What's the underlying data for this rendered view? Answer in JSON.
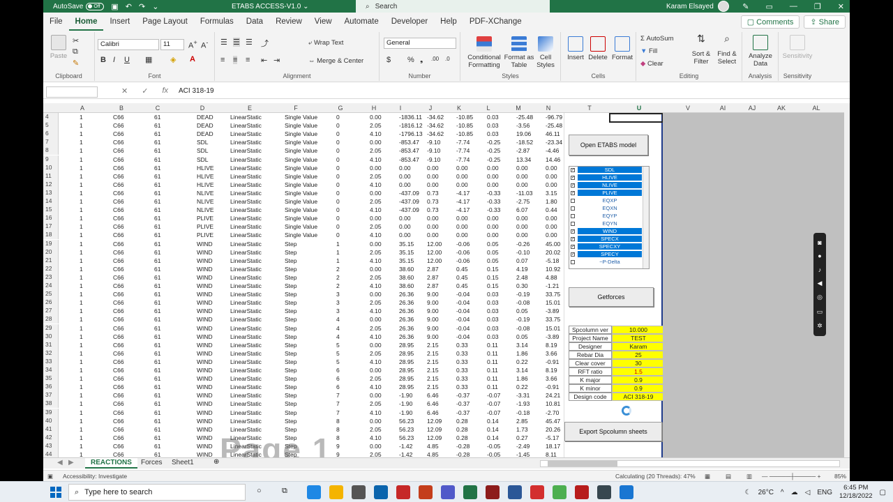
{
  "title_bar": {
    "autosave_label": "AutoSave",
    "autosave_state": "Off",
    "document_title": "ETABS ACCESS-V1.0 ⌄",
    "search_placeholder": "Search",
    "user_name": "Karam Elsayed"
  },
  "menu": {
    "tabs": [
      "File",
      "Home",
      "Insert",
      "Page Layout",
      "Formulas",
      "Data",
      "Review",
      "View",
      "Automate",
      "Developer",
      "Help",
      "PDF-XChange"
    ],
    "active_tab": "Home",
    "comments_label": "Comments",
    "share_label": "Share"
  },
  "ribbon": {
    "clipboard": {
      "paste": "Paste",
      "group": "Clipboard"
    },
    "font": {
      "name": "Calibri",
      "size": "11",
      "group": "Font"
    },
    "alignment": {
      "wrap": "Wrap Text",
      "merge": "Merge & Center",
      "group": "Alignment"
    },
    "number": {
      "format": "General",
      "group": "Number"
    },
    "styles": {
      "conditional": "Conditional Formatting",
      "format_table": "Format as Table",
      "cell_styles": "Cell Styles",
      "group": "Styles"
    },
    "cells": {
      "insert": "Insert",
      "delete": "Delete",
      "format": "Format",
      "group": "Cells"
    },
    "editing": {
      "autosum": "AutoSum",
      "fill": "Fill",
      "clear": "Clear",
      "sort": "Sort & Filter",
      "find": "Find & Select",
      "group": "Editing"
    },
    "analysis": {
      "analyze": "Analyze Data",
      "group": "Analysis"
    },
    "sensitivity": {
      "label": "Sensitivity",
      "group": "Sensitivity"
    }
  },
  "formula_bar": {
    "name_box": "",
    "content": "ACI 318-19"
  },
  "columns": [
    "A",
    "B",
    "C",
    "D",
    "E",
    "F",
    "G",
    "H",
    "I",
    "J",
    "K",
    "L",
    "M",
    "N",
    "T",
    "U",
    "V",
    "AI",
    "AJ",
    "AK",
    "AL"
  ],
  "rows": [
    [
      "4",
      "1",
      "C66",
      "61",
      "DEAD",
      "LinearStatic",
      "Single Value",
      "0",
      "0.00",
      "-1836.11",
      "-34.62",
      "-10.85",
      "0.03",
      "-25.48",
      "-96.79"
    ],
    [
      "5",
      "1",
      "C66",
      "61",
      "DEAD",
      "LinearStatic",
      "Single Value",
      "0",
      "2.05",
      "-1816.12",
      "-34.62",
      "-10.85",
      "0.03",
      "-3.56",
      "-25.48"
    ],
    [
      "6",
      "1",
      "C66",
      "61",
      "DEAD",
      "LinearStatic",
      "Single Value",
      "0",
      "4.10",
      "-1796.13",
      "-34.62",
      "-10.85",
      "0.03",
      "19.06",
      "46.11"
    ],
    [
      "7",
      "1",
      "C66",
      "61",
      "SDL",
      "LinearStatic",
      "Single Value",
      "0",
      "0.00",
      "-853.47",
      "-9.10",
      "-7.74",
      "-0.25",
      "-18.52",
      "-23.34"
    ],
    [
      "8",
      "1",
      "C66",
      "61",
      "SDL",
      "LinearStatic",
      "Single Value",
      "0",
      "2.05",
      "-853.47",
      "-9.10",
      "-7.74",
      "-0.25",
      "-2.87",
      "-4.46"
    ],
    [
      "9",
      "1",
      "C66",
      "61",
      "SDL",
      "LinearStatic",
      "Single Value",
      "0",
      "4.10",
      "-853.47",
      "-9.10",
      "-7.74",
      "-0.25",
      "13.34",
      "14.46"
    ],
    [
      "10",
      "1",
      "C66",
      "61",
      "HLIVE",
      "LinearStatic",
      "Single Value",
      "0",
      "0.00",
      "0.00",
      "0.00",
      "0.00",
      "0.00",
      "0.00",
      "0.00"
    ],
    [
      "11",
      "1",
      "C66",
      "61",
      "HLIVE",
      "LinearStatic",
      "Single Value",
      "0",
      "2.05",
      "0.00",
      "0.00",
      "0.00",
      "0.00",
      "0.00",
      "0.00"
    ],
    [
      "12",
      "1",
      "C66",
      "61",
      "HLIVE",
      "LinearStatic",
      "Single Value",
      "0",
      "4.10",
      "0.00",
      "0.00",
      "0.00",
      "0.00",
      "0.00",
      "0.00"
    ],
    [
      "13",
      "1",
      "C66",
      "61",
      "NLIVE",
      "LinearStatic",
      "Single Value",
      "0",
      "0.00",
      "-437.09",
      "0.73",
      "-4.17",
      "-0.33",
      "-11.03",
      "3.15"
    ],
    [
      "14",
      "1",
      "C66",
      "61",
      "NLIVE",
      "LinearStatic",
      "Single Value",
      "0",
      "2.05",
      "-437.09",
      "0.73",
      "-4.17",
      "-0.33",
      "-2.75",
      "1.80"
    ],
    [
      "15",
      "1",
      "C66",
      "61",
      "NLIVE",
      "LinearStatic",
      "Single Value",
      "0",
      "4.10",
      "-437.09",
      "0.73",
      "-4.17",
      "-0.33",
      "6.07",
      "0.44"
    ],
    [
      "16",
      "1",
      "C66",
      "61",
      "PLIVE",
      "LinearStatic",
      "Single Value",
      "0",
      "0.00",
      "0.00",
      "0.00",
      "0.00",
      "0.00",
      "0.00",
      "0.00"
    ],
    [
      "17",
      "1",
      "C66",
      "61",
      "PLIVE",
      "LinearStatic",
      "Single Value",
      "0",
      "2.05",
      "0.00",
      "0.00",
      "0.00",
      "0.00",
      "0.00",
      "0.00"
    ],
    [
      "18",
      "1",
      "C66",
      "61",
      "PLIVE",
      "LinearStatic",
      "Single Value",
      "0",
      "4.10",
      "0.00",
      "0.00",
      "0.00",
      "0.00",
      "0.00",
      "0.00"
    ],
    [
      "19",
      "1",
      "C66",
      "61",
      "WIND",
      "LinearStatic",
      "Step",
      "1",
      "0.00",
      "35.15",
      "12.00",
      "-0.06",
      "0.05",
      "-0.26",
      "45.00"
    ],
    [
      "20",
      "1",
      "C66",
      "61",
      "WIND",
      "LinearStatic",
      "Step",
      "1",
      "2.05",
      "35.15",
      "12.00",
      "-0.06",
      "0.05",
      "-0.10",
      "20.02"
    ],
    [
      "21",
      "1",
      "C66",
      "61",
      "WIND",
      "LinearStatic",
      "Step",
      "1",
      "4.10",
      "35.15",
      "12.00",
      "-0.06",
      "0.05",
      "0.07",
      "-5.18"
    ],
    [
      "22",
      "1",
      "C66",
      "61",
      "WIND",
      "LinearStatic",
      "Step",
      "2",
      "0.00",
      "38.60",
      "2.87",
      "0.45",
      "0.15",
      "4.19",
      "10.92"
    ],
    [
      "23",
      "1",
      "C66",
      "61",
      "WIND",
      "LinearStatic",
      "Step",
      "2",
      "2.05",
      "38.60",
      "2.87",
      "0.45",
      "0.15",
      "2.48",
      "4.88"
    ],
    [
      "24",
      "1",
      "C66",
      "61",
      "WIND",
      "LinearStatic",
      "Step",
      "2",
      "4.10",
      "38.60",
      "2.87",
      "0.45",
      "0.15",
      "0.30",
      "-1.21"
    ],
    [
      "25",
      "1",
      "C66",
      "61",
      "WIND",
      "LinearStatic",
      "Step",
      "3",
      "0.00",
      "26.36",
      "9.00",
      "-0.04",
      "0.03",
      "-0.19",
      "33.75"
    ],
    [
      "26",
      "1",
      "C66",
      "61",
      "WIND",
      "LinearStatic",
      "Step",
      "3",
      "2.05",
      "26.36",
      "9.00",
      "-0.04",
      "0.03",
      "-0.08",
      "15.01"
    ],
    [
      "27",
      "1",
      "C66",
      "61",
      "WIND",
      "LinearStatic",
      "Step",
      "3",
      "4.10",
      "26.36",
      "9.00",
      "-0.04",
      "0.03",
      "0.05",
      "-3.89"
    ],
    [
      "28",
      "1",
      "C66",
      "61",
      "WIND",
      "LinearStatic",
      "Step",
      "4",
      "0.00",
      "26.36",
      "9.00",
      "-0.04",
      "0.03",
      "-0.19",
      "33.75"
    ],
    [
      "29",
      "1",
      "C66",
      "61",
      "WIND",
      "LinearStatic",
      "Step",
      "4",
      "2.05",
      "26.36",
      "9.00",
      "-0.04",
      "0.03",
      "-0.08",
      "15.01"
    ],
    [
      "30",
      "1",
      "C66",
      "61",
      "WIND",
      "LinearStatic",
      "Step",
      "4",
      "4.10",
      "26.36",
      "9.00",
      "-0.04",
      "0.03",
      "0.05",
      "-3.89"
    ],
    [
      "31",
      "1",
      "C66",
      "61",
      "WIND",
      "LinearStatic",
      "Step",
      "5",
      "0.00",
      "28.95",
      "2.15",
      "0.33",
      "0.11",
      "3.14",
      "8.19"
    ],
    [
      "32",
      "1",
      "C66",
      "61",
      "WIND",
      "LinearStatic",
      "Step",
      "5",
      "2.05",
      "28.95",
      "2.15",
      "0.33",
      "0.11",
      "1.86",
      "3.66"
    ],
    [
      "33",
      "1",
      "C66",
      "61",
      "WIND",
      "LinearStatic",
      "Step",
      "5",
      "4.10",
      "28.95",
      "2.15",
      "0.33",
      "0.11",
      "0.22",
      "-0.91"
    ],
    [
      "34",
      "1",
      "C66",
      "61",
      "WIND",
      "LinearStatic",
      "Step",
      "6",
      "0.00",
      "28.95",
      "2.15",
      "0.33",
      "0.11",
      "3.14",
      "8.19"
    ],
    [
      "35",
      "1",
      "C66",
      "61",
      "WIND",
      "LinearStatic",
      "Step",
      "6",
      "2.05",
      "28.95",
      "2.15",
      "0.33",
      "0.11",
      "1.86",
      "3.66"
    ],
    [
      "36",
      "1",
      "C66",
      "61",
      "WIND",
      "LinearStatic",
      "Step",
      "6",
      "4.10",
      "28.95",
      "2.15",
      "0.33",
      "0.11",
      "0.22",
      "-0.91"
    ],
    [
      "37",
      "1",
      "C66",
      "61",
      "WIND",
      "LinearStatic",
      "Step",
      "7",
      "0.00",
      "-1.90",
      "6.46",
      "-0.37",
      "-0.07",
      "-3.31",
      "24.21"
    ],
    [
      "38",
      "1",
      "C66",
      "61",
      "WIND",
      "LinearStatic",
      "Step",
      "7",
      "2.05",
      "-1.90",
      "6.46",
      "-0.37",
      "-0.07",
      "-1.93",
      "10.81"
    ],
    [
      "39",
      "1",
      "C66",
      "61",
      "WIND",
      "LinearStatic",
      "Step",
      "7",
      "4.10",
      "-1.90",
      "6.46",
      "-0.37",
      "-0.07",
      "-0.18",
      "-2.70"
    ],
    [
      "40",
      "1",
      "C66",
      "61",
      "WIND",
      "LinearStatic",
      "Step",
      "8",
      "0.00",
      "56.23",
      "12.09",
      "0.28",
      "0.14",
      "2.85",
      "45.47"
    ],
    [
      "41",
      "1",
      "C66",
      "61",
      "WIND",
      "LinearStatic",
      "Step",
      "8",
      "2.05",
      "56.23",
      "12.09",
      "0.28",
      "0.14",
      "1.73",
      "20.26"
    ],
    [
      "42",
      "1",
      "C66",
      "61",
      "WIND",
      "LinearStatic",
      "Step",
      "8",
      "4.10",
      "56.23",
      "12.09",
      "0.28",
      "0.14",
      "0.27",
      "-5.17"
    ],
    [
      "43",
      "1",
      "C66",
      "61",
      "WIND",
      "LinearStatic",
      "Step",
      "9",
      "0.00",
      "-1.42",
      "4.85",
      "-0.28",
      "-0.05",
      "-2.49",
      "18.17"
    ],
    [
      "44",
      "1",
      "C66",
      "61",
      "WIND",
      "LinearStatic",
      "Step",
      "9",
      "2.05",
      "-1.42",
      "4.85",
      "-0.28",
      "-0.05",
      "-1.45",
      "8.11"
    ]
  ],
  "panel": {
    "open_button": "Open ETABS model",
    "load_cases": [
      {
        "label": "SDL",
        "checked": true
      },
      {
        "label": "HLIVE",
        "checked": true
      },
      {
        "label": "NLIVE",
        "checked": true
      },
      {
        "label": "PLIVE",
        "checked": true
      },
      {
        "label": "EQXP",
        "checked": false
      },
      {
        "label": "EQXN",
        "checked": false
      },
      {
        "label": "EQYP",
        "checked": false
      },
      {
        "label": "EQYN",
        "checked": false
      },
      {
        "label": "WIND",
        "checked": true
      },
      {
        "label": "SPECX",
        "checked": true
      },
      {
        "label": "SPECXY",
        "checked": true
      },
      {
        "label": "SPECY",
        "checked": true
      },
      {
        "label": "~P-Delta",
        "checked": false
      }
    ],
    "getforces_button": "Getforces",
    "params": [
      {
        "key": "Spcolumn ver",
        "value": "10.000"
      },
      {
        "key": "Project Name",
        "value": "TEST"
      },
      {
        "key": "Designer",
        "value": "Karam"
      },
      {
        "key": "Rebar Dia",
        "value": "25"
      },
      {
        "key": "Clear cover",
        "value": "30"
      },
      {
        "key": "RFT ratio",
        "value": "1.5"
      },
      {
        "key": "K major",
        "value": "0.9"
      },
      {
        "key": "K minor",
        "value": "0.9"
      },
      {
        "key": "Design code",
        "value": "ACI 318-19"
      }
    ],
    "export_button": "Export Spcolumn sheets"
  },
  "watermark": "Page 1",
  "sheets": {
    "tabs": [
      "REACTIONS",
      "Forces",
      "Sheet1"
    ],
    "active": "REACTIONS"
  },
  "status": {
    "accessibility": "Accessibility: Investigate",
    "calculating": "Calculating (20 Threads): 47%",
    "zoom": "85%"
  },
  "taskbar": {
    "search_placeholder": "Type here to search",
    "temperature": "26°C",
    "language": "ENG",
    "time": "6:45 PM",
    "date": "12/18/2022"
  },
  "colors": {
    "excel_green": "#217346",
    "selection_blue": "#0078d7",
    "highlight_yellow": "#ffff00"
  }
}
